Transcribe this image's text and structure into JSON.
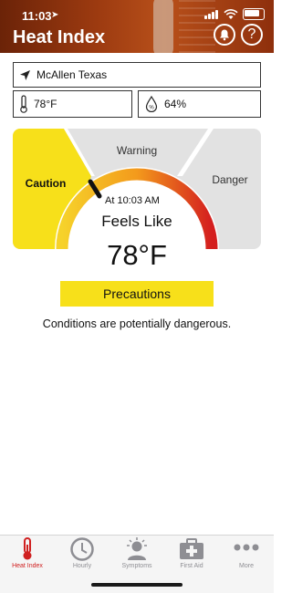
{
  "status": {
    "time": "11:03",
    "location_arrow": "➤"
  },
  "header": {
    "title": "Heat Index",
    "bell_icon": "bell-icon",
    "help_label": "?"
  },
  "location": {
    "name": "McAllen Texas"
  },
  "conditions": {
    "temperature": "78°F",
    "humidity": "64%"
  },
  "gauge": {
    "zones": [
      "Caution",
      "Warning",
      "Danger"
    ],
    "time_label": "At 10:03 AM",
    "feels_like_label": "Feels Like",
    "feels_like_value": "78°F",
    "colors": {
      "caution": "#f7e01a",
      "warning": "#e2e2e2",
      "danger": "#e2e2e2",
      "arc_start": "#f6d22a",
      "arc_end": "#d41e1e"
    }
  },
  "precautions_button": "Precautions",
  "condition_text": "Conditions are potentially dangerous.",
  "tabs": [
    {
      "label": "Heat Index",
      "icon": "thermometer-icon",
      "active": true
    },
    {
      "label": "Hourly",
      "icon": "clock-icon",
      "active": false
    },
    {
      "label": "Symptoms",
      "icon": "person-icon",
      "active": false
    },
    {
      "label": "First Aid",
      "icon": "first-aid-kit-icon",
      "active": false
    },
    {
      "label": "More",
      "icon": "more-dots-icon",
      "active": false
    }
  ]
}
